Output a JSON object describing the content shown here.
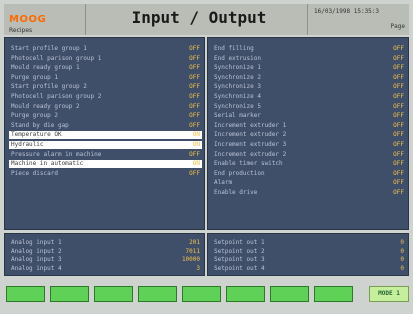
{
  "header": {
    "logo": "MOOG",
    "recipe_label": "Recipes",
    "title": "Input / Output",
    "datetime": "16/03/1998 15:35:3",
    "page_label": "Page"
  },
  "inputs_left": [
    {
      "label": "Start profile group 1",
      "value": "OFF",
      "highlight": false
    },
    {
      "label": "Photocell parison group 1",
      "value": "OFF",
      "highlight": false
    },
    {
      "label": "Mould ready group 1",
      "value": "OFF",
      "highlight": false
    },
    {
      "label": "Purge group 1",
      "value": "OFF",
      "highlight": false
    },
    {
      "label": "Start profile group 2",
      "value": "OFF",
      "highlight": false
    },
    {
      "label": "Photocell parison group 2",
      "value": "OFF",
      "highlight": false
    },
    {
      "label": "Mould ready group 2",
      "value": "OFF",
      "highlight": false
    },
    {
      "label": "Purge group 2",
      "value": "OFF",
      "highlight": false
    },
    {
      "label": "Stand by die gap",
      "value": "OFF",
      "highlight": false
    },
    {
      "label": "Temperature OK",
      "value": "ON",
      "highlight": true
    },
    {
      "label": "Hydraulic",
      "value": "ON",
      "highlight": true
    },
    {
      "label": "Pressure alarm in machine",
      "value": "OFF",
      "highlight": false
    },
    {
      "label": "Machine in automatic",
      "value": "ON",
      "highlight": true
    },
    {
      "label": "Piece discard",
      "value": "OFF",
      "highlight": false
    }
  ],
  "outputs_right": [
    {
      "label": "End filling",
      "value": "OFF"
    },
    {
      "label": "End extrusion",
      "value": "OFF"
    },
    {
      "label": "Synchronize 1",
      "value": "OFF"
    },
    {
      "label": "Synchronize 2",
      "value": "OFF"
    },
    {
      "label": "Synchronize 3",
      "value": "OFF"
    },
    {
      "label": "Synchronize 4",
      "value": "OFF"
    },
    {
      "label": "Synchronize 5",
      "value": "OFF"
    },
    {
      "label": "Serial marker",
      "value": "OFF"
    },
    {
      "label": "Increment extruder 1",
      "value": "OFF"
    },
    {
      "label": "Increment extruder 2",
      "value": "OFF"
    },
    {
      "label": "Increment extruder 3",
      "value": "OFF"
    },
    {
      "label": "Increment extruder 2",
      "value": "OFF"
    },
    {
      "label": "Enable timer switch",
      "value": "OFF"
    },
    {
      "label": "End production",
      "value": "OFF"
    },
    {
      "label": "Alarm",
      "value": "OFF"
    },
    {
      "label": "Enable drive",
      "value": "OFF"
    }
  ],
  "analog_inputs": [
    {
      "label": "Analog input 1",
      "value": "201"
    },
    {
      "label": "Analog input 2",
      "value": "7011"
    },
    {
      "label": "Analog input 3",
      "value": "10000"
    },
    {
      "label": "Analog input 4",
      "value": "3"
    }
  ],
  "analog_outputs": [
    {
      "label": "Setpoint out 1",
      "value": "0"
    },
    {
      "label": "Setpoint out 2",
      "value": "0"
    },
    {
      "label": "Setpoint out 3",
      "value": "0"
    },
    {
      "label": "Setpoint out 4",
      "value": "0"
    }
  ],
  "footer": {
    "mode_label": "MODE 1"
  }
}
